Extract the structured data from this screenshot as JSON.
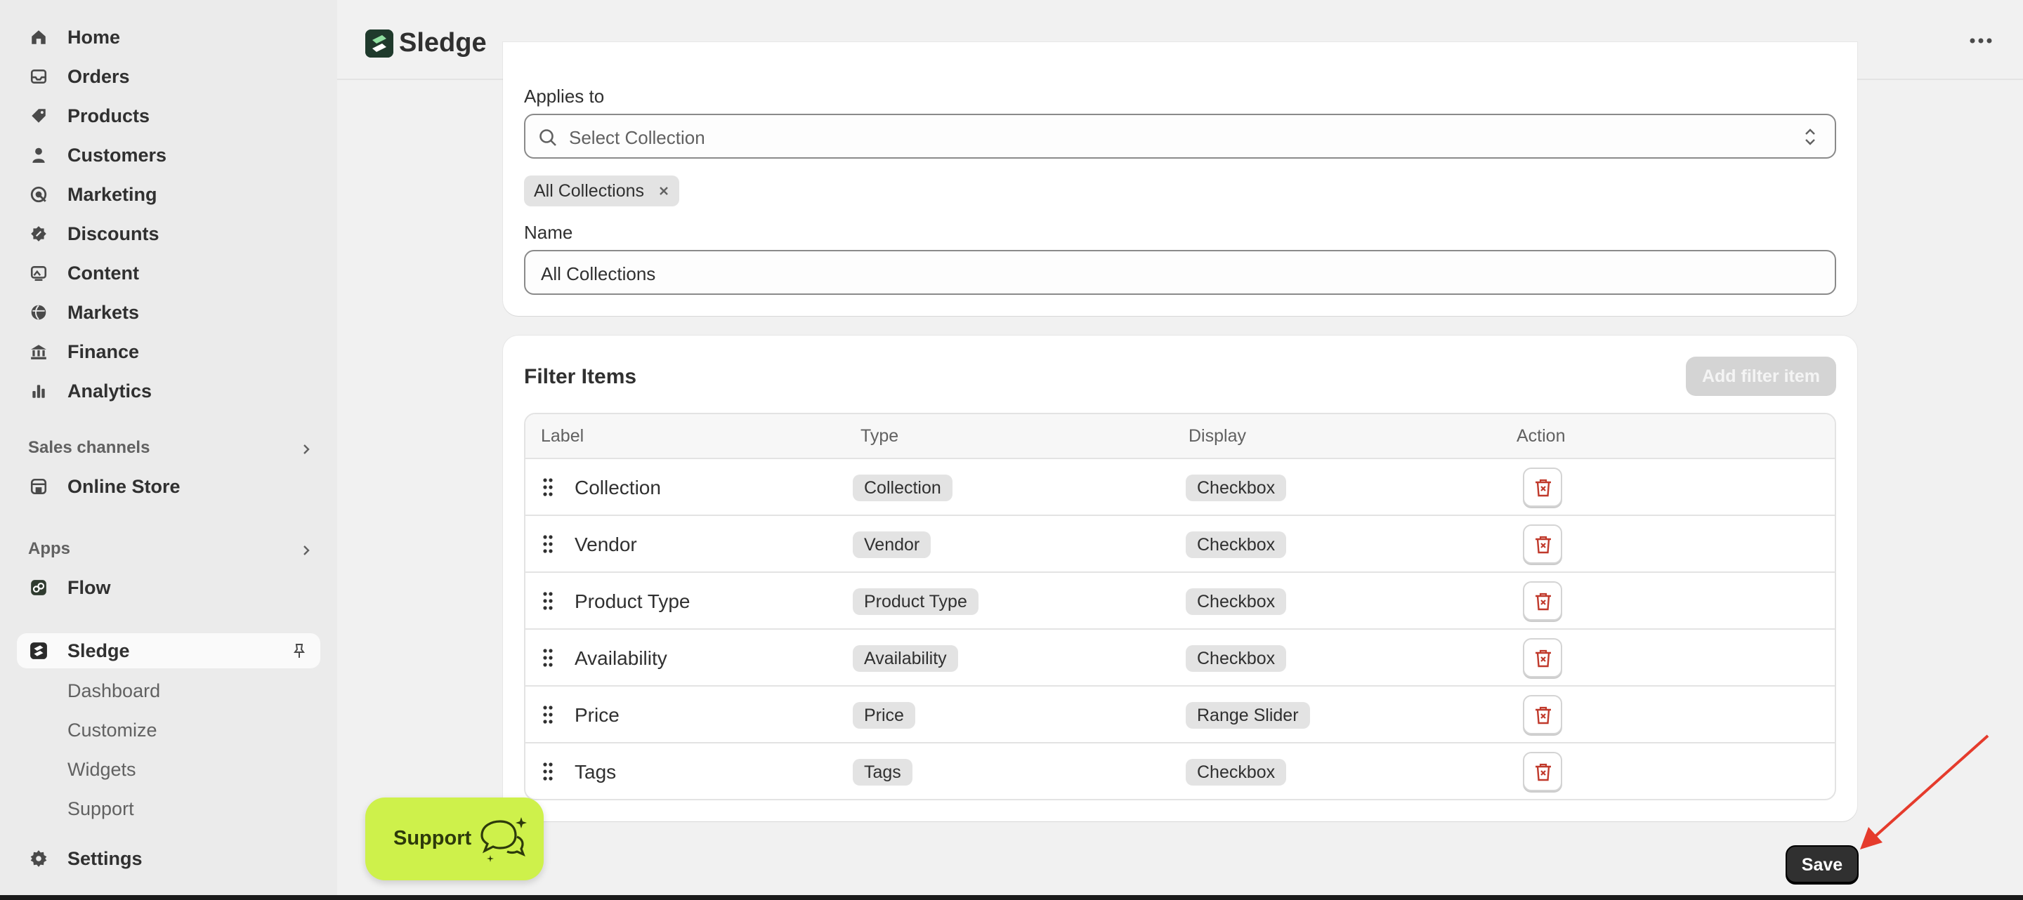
{
  "sidebar": {
    "nav": [
      {
        "label": "Home",
        "icon": "home-icon"
      },
      {
        "label": "Orders",
        "icon": "inbox-icon"
      },
      {
        "label": "Products",
        "icon": "tag-icon"
      },
      {
        "label": "Customers",
        "icon": "person-icon"
      },
      {
        "label": "Marketing",
        "icon": "target-icon"
      },
      {
        "label": "Discounts",
        "icon": "discount-icon"
      },
      {
        "label": "Content",
        "icon": "image-icon"
      },
      {
        "label": "Markets",
        "icon": "globe-icon"
      },
      {
        "label": "Finance",
        "icon": "bank-icon"
      },
      {
        "label": "Analytics",
        "icon": "bar-chart-icon"
      }
    ],
    "sales_channels": {
      "title": "Sales channels",
      "items": [
        {
          "label": "Online Store",
          "icon": "store-icon"
        }
      ]
    },
    "apps": {
      "title": "Apps",
      "items": [
        {
          "label": "Flow",
          "icon": "flow-icon"
        }
      ]
    },
    "active_app": {
      "label": "Sledge",
      "icon": "sledge-logo-icon",
      "pin_icon": "pin-icon"
    },
    "app_subnav": [
      "Dashboard",
      "Customize",
      "Widgets",
      "Support"
    ],
    "settings": {
      "label": "Settings",
      "icon": "gear-icon"
    }
  },
  "topbar": {
    "app_title": "Sledge",
    "more_icon": "more-horizontal-icon"
  },
  "applies_to": {
    "label": "Applies to",
    "select_placeholder": "Select Collection",
    "selected_tag": "All Collections",
    "name_label": "Name",
    "name_value": "All Collections"
  },
  "filter_items": {
    "title": "Filter Items",
    "add_button": "Add filter item",
    "columns": [
      "Label",
      "Type",
      "Display",
      "Action"
    ],
    "rows": [
      {
        "label": "Collection",
        "type": "Collection",
        "display": "Checkbox"
      },
      {
        "label": "Vendor",
        "type": "Vendor",
        "display": "Checkbox"
      },
      {
        "label": "Product Type",
        "type": "Product Type",
        "display": "Checkbox"
      },
      {
        "label": "Availability",
        "type": "Availability",
        "display": "Checkbox"
      },
      {
        "label": "Price",
        "type": "Price",
        "display": "Range Slider"
      },
      {
        "label": "Tags",
        "type": "Tags",
        "display": "Checkbox"
      }
    ]
  },
  "support_button": {
    "label": "Support",
    "icon": "chat-bubbles-icon"
  },
  "save_button": {
    "label": "Save"
  },
  "colors": {
    "accent_lime": "#cef14b",
    "delete_red": "#c0392b",
    "arrow_red": "#e53b2c",
    "primary_dark": "#303030"
  }
}
